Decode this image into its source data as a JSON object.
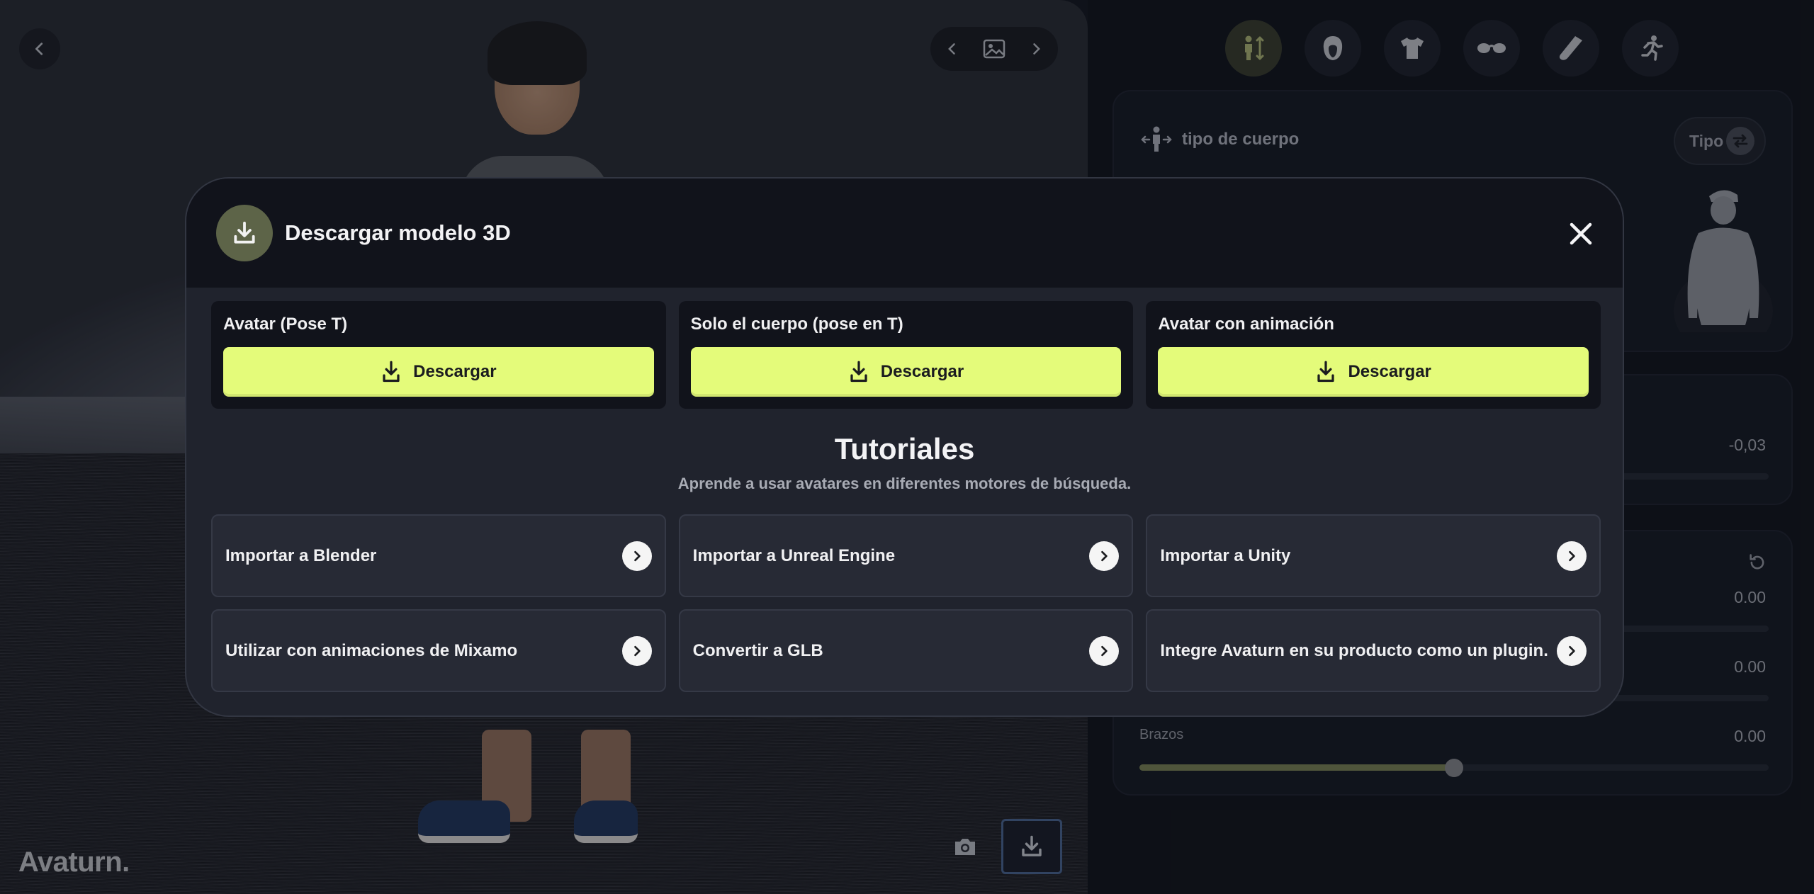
{
  "viewport": {
    "logo": "Avaturn."
  },
  "right_panel": {
    "body_type": {
      "label": "tipo de cuerpo",
      "type_button": "Tipo"
    },
    "value_card": {
      "value": "-0,03"
    },
    "sliders": [
      {
        "value": "0.00",
        "fraction": 0.5
      },
      {
        "value": "0.00",
        "fraction": 0.5
      },
      {
        "label": "Brazos",
        "value": "0.00",
        "fraction": 0.5
      }
    ],
    "category_tabs": [
      "body-icon",
      "head-icon",
      "shirt-icon",
      "glasses-icon",
      "shoe-icon",
      "animation-icon"
    ],
    "active_tab": "body-icon"
  },
  "modal": {
    "title": "Descargar modelo 3D",
    "downloads": [
      {
        "label": "Avatar (Pose T)",
        "button": "Descargar"
      },
      {
        "label": "Solo el cuerpo (pose en T)",
        "button": "Descargar"
      },
      {
        "label": "Avatar con animación",
        "button": "Descargar"
      }
    ],
    "tutorials_title": "Tutoriales",
    "tutorials_subtitle": "Aprende a usar avatares en diferentes motores de búsqueda.",
    "tutorials": [
      "Importar a Blender",
      "Importar a Unreal Engine",
      "Importar a Unity",
      "Utilizar con animaciones de Mixamo",
      "Convertir a GLB",
      "Integre Avaturn en su producto como un plugin."
    ]
  },
  "colors": {
    "accent": "#e4fb7a",
    "modal_bg": "#20232d",
    "header_bg": "#11131b",
    "icon_badge": "#5d6448"
  }
}
